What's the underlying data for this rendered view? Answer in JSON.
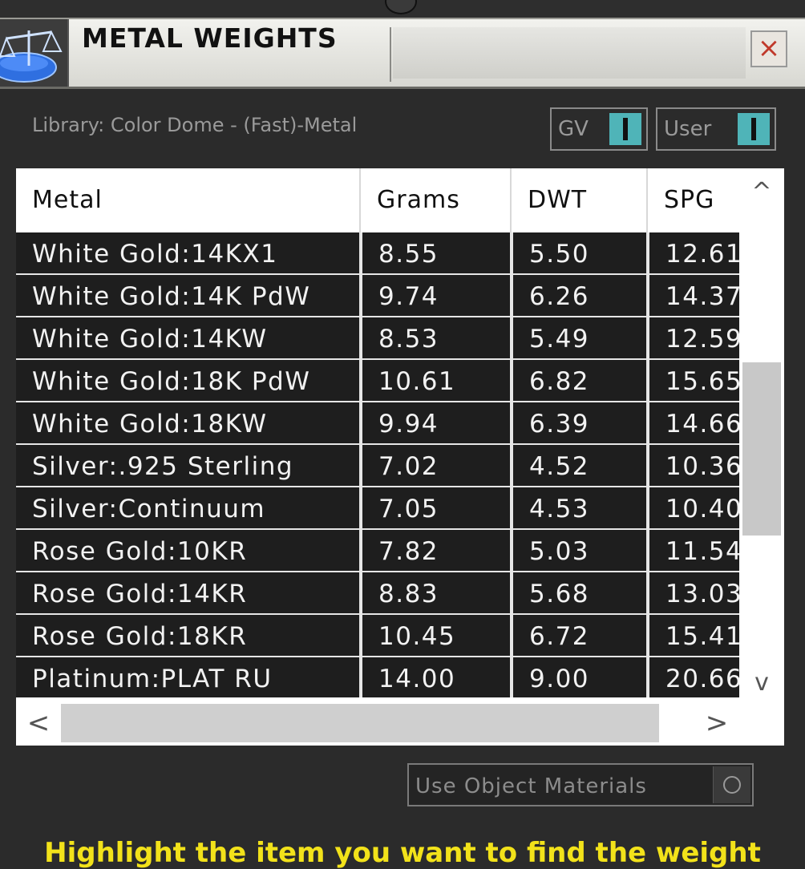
{
  "window": {
    "title": "METAL WEIGHTS",
    "close_label": "×"
  },
  "library_label": "Library: Color Dome - (Fast)-Metal",
  "toggles": [
    {
      "label": "GV",
      "on": true
    },
    {
      "label": "User",
      "on": true
    }
  ],
  "table": {
    "columns": [
      "Metal",
      "Grams",
      "DWT",
      "SPG"
    ],
    "rows": [
      [
        "White Gold:14KX1",
        "8.55",
        "5.50",
        "12.61"
      ],
      [
        "White Gold:14K PdW",
        "9.74",
        "6.26",
        "14.37"
      ],
      [
        "White Gold:14KW",
        "8.53",
        "5.49",
        "12.59"
      ],
      [
        "White Gold:18K PdW",
        "10.61",
        "6.82",
        "15.65"
      ],
      [
        "White Gold:18KW",
        "9.94",
        "6.39",
        "14.66"
      ],
      [
        "Silver:.925 Sterling",
        "7.02",
        "4.52",
        "10.36"
      ],
      [
        "Silver:Continuum",
        "7.05",
        "4.53",
        "10.40"
      ],
      [
        "Rose Gold:10KR",
        "7.82",
        "5.03",
        "11.54"
      ],
      [
        "Rose Gold:14KR",
        "8.83",
        "5.68",
        "13.03"
      ],
      [
        "Rose Gold:18KR",
        "10.45",
        "6.72",
        "15.41"
      ],
      [
        "Platinum:PLAT RU",
        "14.00",
        "9.00",
        "20.66"
      ]
    ]
  },
  "scroll": {
    "up": "^",
    "down": "v",
    "left": "<",
    "right": ">"
  },
  "use_object_materials_label": "Use Object Materials",
  "hint": "Highlight the item you want to find the weight",
  "colors": {
    "accent": "#4fb4b8",
    "hint": "#f2e21a",
    "row_bg": "#1e1e1e"
  }
}
